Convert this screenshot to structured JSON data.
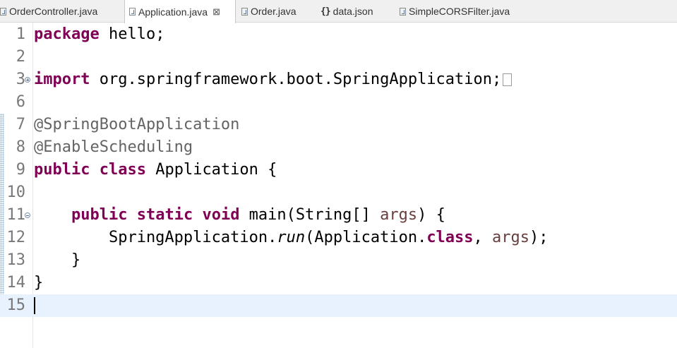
{
  "tabs": [
    {
      "label": "OrderController.java",
      "icon": "java-file-icon",
      "active": false
    },
    {
      "label": "Application.java",
      "icon": "java-file-icon",
      "active": true,
      "close": "⊠"
    },
    {
      "label": "Order.java",
      "icon": "java-file-icon",
      "active": false
    },
    {
      "label": "data.json",
      "icon": "json-file-icon",
      "icon_glyph": "{}",
      "active": false
    },
    {
      "label": "SimpleCORSFilter.java",
      "icon": "java-file-icon",
      "active": false
    }
  ],
  "editor": {
    "lines": [
      {
        "num": "1",
        "tokens": [
          {
            "t": "package",
            "c": "kw"
          },
          {
            "t": " hello;"
          }
        ]
      },
      {
        "num": "2",
        "tokens": []
      },
      {
        "num": "3",
        "fold": "plus",
        "collapsed": true,
        "tokens": [
          {
            "t": "import",
            "c": "kw"
          },
          {
            "t": " org.springframework.boot.SpringApplication;"
          }
        ]
      },
      {
        "num": "6",
        "tokens": []
      },
      {
        "num": "7",
        "tokens": [
          {
            "t": "@SpringBootApplication",
            "c": "ann"
          }
        ]
      },
      {
        "num": "8",
        "tokens": [
          {
            "t": "@EnableScheduling",
            "c": "ann"
          }
        ]
      },
      {
        "num": "9",
        "tokens": [
          {
            "t": "public",
            "c": "kw"
          },
          {
            "t": " "
          },
          {
            "t": "class",
            "c": "kw"
          },
          {
            "t": " Application {"
          }
        ]
      },
      {
        "num": "10",
        "tokens": []
      },
      {
        "num": "11",
        "fold": "minus",
        "tokens": [
          {
            "t": "    "
          },
          {
            "t": "public",
            "c": "kw"
          },
          {
            "t": " "
          },
          {
            "t": "static",
            "c": "kw"
          },
          {
            "t": " "
          },
          {
            "t": "void",
            "c": "kw"
          },
          {
            "t": " main(String[] "
          },
          {
            "t": "args",
            "c": "var"
          },
          {
            "t": ") {"
          }
        ]
      },
      {
        "num": "12",
        "tokens": [
          {
            "t": "        SpringApplication."
          },
          {
            "t": "run",
            "c": "it"
          },
          {
            "t": "(Application."
          },
          {
            "t": "class",
            "c": "kw"
          },
          {
            "t": ", "
          },
          {
            "t": "args",
            "c": "var"
          },
          {
            "t": ");"
          }
        ]
      },
      {
        "num": "13",
        "tokens": [
          {
            "t": "    }"
          }
        ]
      },
      {
        "num": "14",
        "tokens": [
          {
            "t": "}"
          }
        ]
      },
      {
        "num": "15",
        "current": true,
        "tokens": []
      }
    ]
  },
  "colors": {
    "keyword": "#7f0055",
    "annotation": "#646464",
    "variable": "#6a3e3e",
    "current_line": "#e8f2fe"
  }
}
